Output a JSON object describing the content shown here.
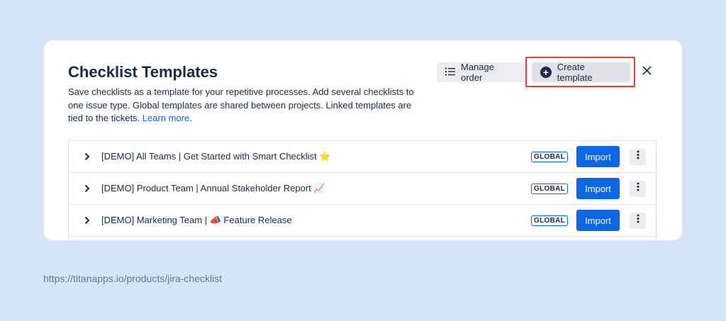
{
  "dialog": {
    "title": "Checklist Templates",
    "description": "Save checklists as a template for your repetitive processes. Add several checklists to one issue type. Global templates are shared between projects. Linked templates are tied to the tickets.",
    "learn_more": "Learn more",
    "period": ".",
    "manage_order_label": "Manage order",
    "create_template_label": "Create template",
    "close_icon": "close-icon"
  },
  "templates": [
    {
      "name": "[DEMO] All Teams | Get Started with Smart Checklist ⭐️",
      "badge": "GLOBAL",
      "import_label": "Import"
    },
    {
      "name": "[DEMO] Product Team | Annual Stakeholder Report 📈",
      "badge": "GLOBAL",
      "import_label": "Import"
    },
    {
      "name": "[DEMO] Marketing Team | 📣 Feature Release",
      "badge": "GLOBAL",
      "import_label": "Import"
    }
  ],
  "footer": {
    "url": "https://titanapps.io/products/jira-checklist"
  },
  "colors": {
    "accent": "#0c66e4",
    "highlight": "#e2442f",
    "background": "#d5e4f7"
  }
}
